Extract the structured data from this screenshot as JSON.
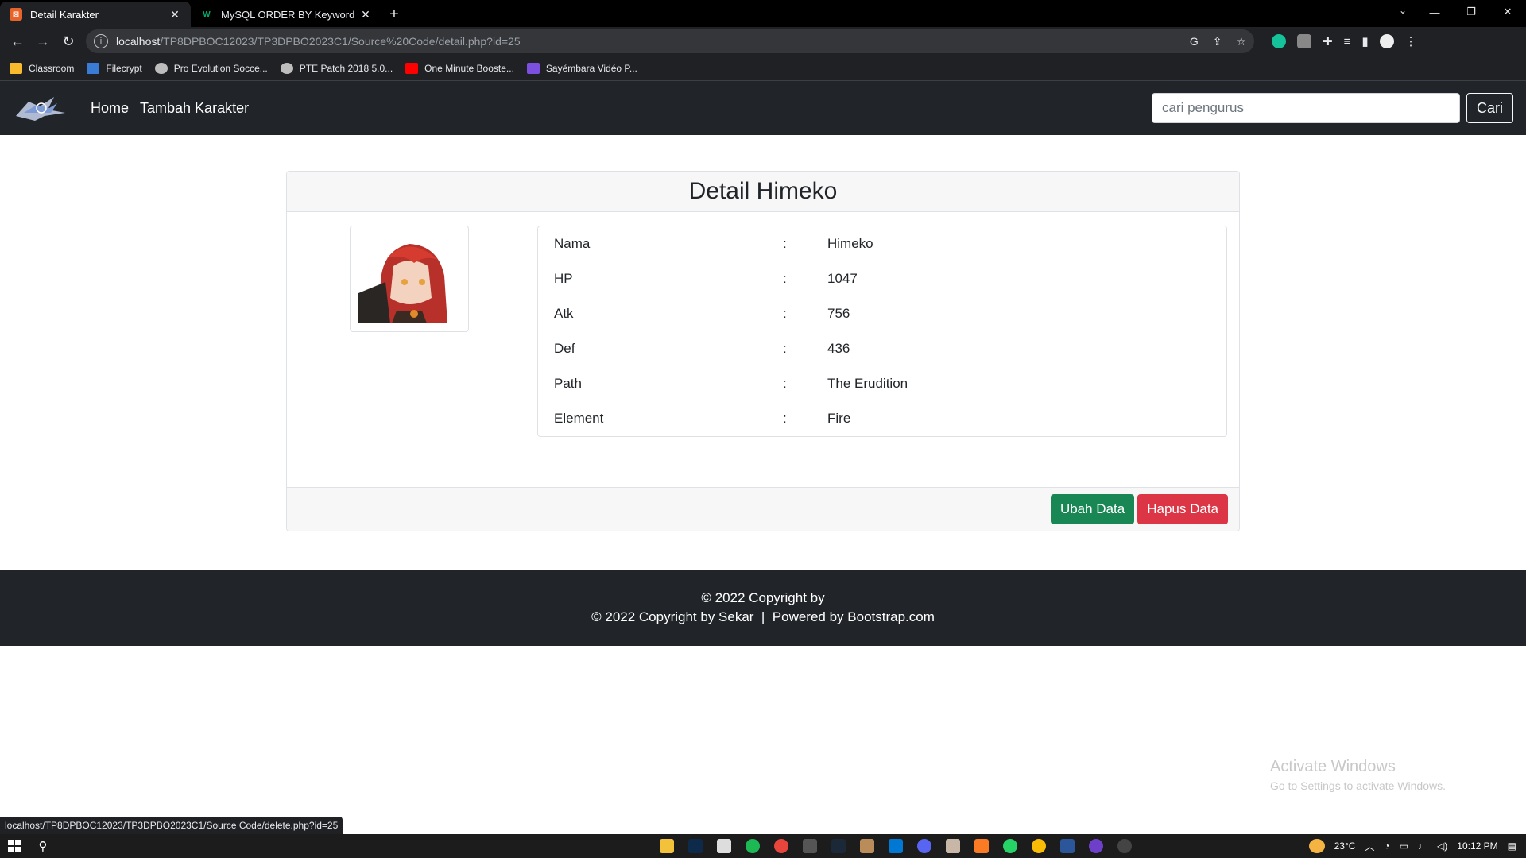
{
  "browser": {
    "tabs": [
      {
        "title": "Detail Karakter",
        "active": true,
        "favicon_color": "#e8632a"
      },
      {
        "title": "MySQL ORDER BY Keyword",
        "active": false,
        "favicon_color": "#04aa6d"
      }
    ],
    "url_host": "localhost",
    "url_path": "/TP8DPBOC12023/TP3DPBO2023C1/Source%20Code/detail.php?id=25",
    "bookmarks": [
      {
        "label": "Classroom",
        "color": "#f9bb2d"
      },
      {
        "label": "Filecrypt",
        "color": "#3a7bd5"
      },
      {
        "label": "Pro Evolution Socce...",
        "color": "#bdbdbd"
      },
      {
        "label": "PTE Patch 2018 5.0...",
        "color": "#bdbdbd"
      },
      {
        "label": "One Minute Booste...",
        "color": "#ff0000"
      },
      {
        "label": "Sayémbara Vidéo P...",
        "color": "#7b4fe0"
      }
    ],
    "status_url": "localhost/TP8DPBOC12023/TP3DPBO2023C1/Source Code/delete.php?id=25"
  },
  "navbar": {
    "links": [
      "Home",
      "Tambah Karakter"
    ],
    "search_placeholder": "cari pengurus",
    "search_button": "Cari"
  },
  "detail": {
    "title": "Detail Himeko",
    "fields": [
      {
        "label": "Nama",
        "sep": ":",
        "value": "Himeko"
      },
      {
        "label": "HP",
        "sep": ":",
        "value": "1047"
      },
      {
        "label": "Atk",
        "sep": ":",
        "value": "756"
      },
      {
        "label": "Def",
        "sep": ":",
        "value": "436"
      },
      {
        "label": "Path",
        "sep": ":",
        "value": "The Erudition"
      },
      {
        "label": "Element",
        "sep": ":",
        "value": "Fire"
      }
    ],
    "edit_button": "Ubah Data",
    "delete_button": "Hapus Data"
  },
  "footer": {
    "line1": "© 2022 Copyright by",
    "line2": "© 2022 Copyright by Sekar  |  Powered by Bootstrap.com"
  },
  "watermark": {
    "title": "Activate Windows",
    "subtitle": "Go to Settings to activate Windows."
  },
  "taskbar": {
    "temperature": "23°C",
    "time": "10:12 PM"
  },
  "colors": {
    "navbar_bg": "#212529",
    "success": "#198754",
    "danger": "#dc3545"
  }
}
